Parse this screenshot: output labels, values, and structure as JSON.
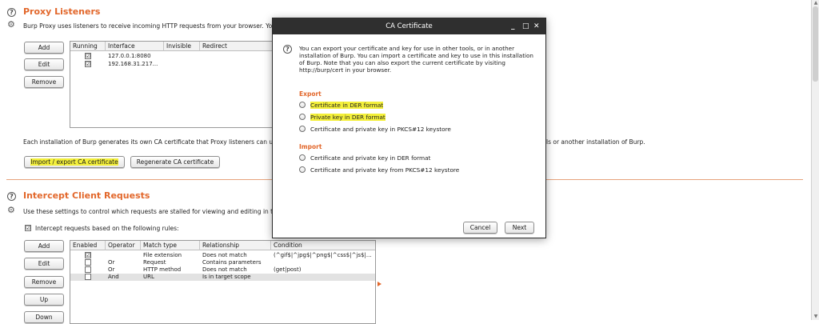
{
  "proxy": {
    "title": "Proxy Listeners",
    "description": "Burp Proxy uses listeners to receive incoming HTTP requests from your browser. You",
    "buttons": {
      "add": "Add",
      "edit": "Edit",
      "remove": "Remove"
    },
    "columns": [
      "Running",
      "Interface",
      "Invisible",
      "Redirect"
    ],
    "rows": [
      {
        "running": "☑",
        "interface": "127.0.0.1:8080",
        "invisible": "",
        "redirect": ""
      },
      {
        "running": "☑",
        "interface": "192.168.31.217...",
        "invisible": "",
        "redirect": ""
      }
    ],
    "ca_text_left": "Each installation of Burp generates its own CA certificate that Proxy listeners can use",
    "ca_text_right": "ls or another installation of Burp.",
    "import_export_label": "Import / export CA certificate",
    "regenerate_label": "Regenerate CA certificate",
    "highlight_color": "#f4f03a"
  },
  "intercept": {
    "title": "Intercept Client Requests",
    "description": "Use these settings to control which requests are stalled for viewing and editing in the I",
    "checkbox_label": "Intercept requests based on the following rules:",
    "buttons": {
      "add": "Add",
      "edit": "Edit",
      "remove": "Remove",
      "up": "Up",
      "down": "Down"
    },
    "columns": [
      "Enabled",
      "Operator",
      "Match type",
      "Relationship",
      "Condition"
    ],
    "rows": [
      {
        "enabled": "☑",
        "operator": "",
        "match_type": "File extension",
        "relationship": "Does not match",
        "condition": "(^gif$|^jpg$|^png$|^css$|^js$|..."
      },
      {
        "enabled": "",
        "operator": "Or",
        "match_type": "Request",
        "relationship": "Contains parameters",
        "condition": ""
      },
      {
        "enabled": "",
        "operator": "Or",
        "match_type": "HTTP method",
        "relationship": "Does not match",
        "condition": "(get|post)"
      },
      {
        "enabled": "",
        "operator": "And",
        "match_type": "URL",
        "relationship": "Is in target scope",
        "condition": ""
      }
    ]
  },
  "dialog": {
    "title": "CA Certificate",
    "controls": {
      "minimize": "_",
      "maximize": "□",
      "close": "✕"
    },
    "intro": "You can export your certificate and key for use in other tools, or in another installation of Burp. You can import a certificate and key to use in this installation of Burp. Note that you can also export the current certificate by visiting http://burp/cert in your browser.",
    "export_heading": "Export",
    "export_options": [
      "Certificate in DER format",
      "Private key in DER format",
      "Certificate and private key in PKCS#12 keystore"
    ],
    "import_heading": "Import",
    "import_options": [
      "Certificate and private key in DER format",
      "Certificate and private key from PKCS#12 keystore"
    ],
    "cancel_label": "Cancel",
    "next_label": "Next"
  },
  "colors": {
    "accent": "#e2672b",
    "titlebar": "#2f2f2f",
    "highlight": "#f4f03a"
  }
}
